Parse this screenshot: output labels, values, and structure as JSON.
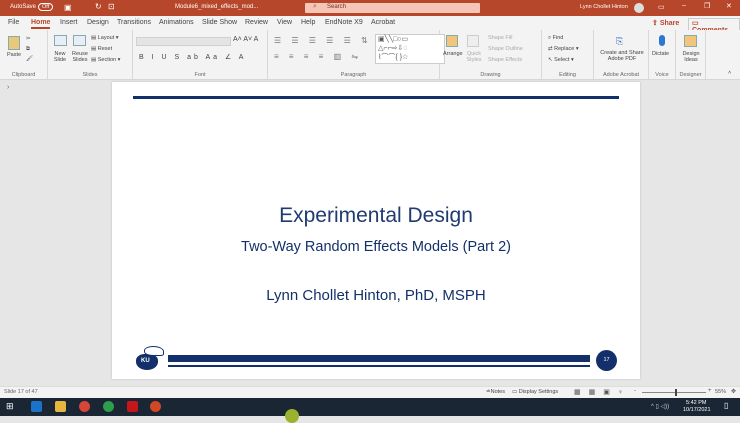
{
  "titlebar": {
    "autosave": "AutoSave",
    "autosave_state": "Off",
    "filename": "Module6_mixed_effects_mod...",
    "search_placeholder": "Search",
    "user": "Lynn Chollet Hinton",
    "accent": "#b7472a"
  },
  "tabs": [
    "File",
    "Home",
    "Insert",
    "Design",
    "Transitions",
    "Animations",
    "Slide Show",
    "Review",
    "View",
    "Help",
    "EndNote X9",
    "Acrobat"
  ],
  "active_tab": "Home",
  "share": "Share",
  "comments": "Comments",
  "ribbon": {
    "clipboard": {
      "label": "Clipboard",
      "paste": "Paste"
    },
    "slides": {
      "label": "Slides",
      "new_slide": "New Slide",
      "reuse": "Reuse Slides",
      "layout": "Layout",
      "reset": "Reset",
      "section": "Section"
    },
    "font": {
      "label": "Font"
    },
    "paragraph": {
      "label": "Paragraph"
    },
    "drawing": {
      "label": "Drawing",
      "arrange": "Arrange",
      "quick_styles": "Quick Styles",
      "shape_fill": "Shape Fill",
      "shape_outline": "Shape Outline",
      "shape_effects": "Shape Effects"
    },
    "editing": {
      "label": "Editing",
      "find": "Find",
      "replace": "Replace",
      "select": "Select"
    },
    "acrobat": {
      "label": "Adobe Acrobat",
      "create": "Create and Share Adobe PDF"
    },
    "voice": {
      "label": "Voice",
      "dictate": "Dictate"
    },
    "designer": {
      "label": "Designer",
      "design_ideas": "Design Ideas"
    }
  },
  "slide": {
    "title": "Experimental Design",
    "subtitle": "Two-Way Random Effects Models (Part 2)",
    "author": "Lynn Chollet Hinton, PhD, MSPH",
    "number": "17",
    "logo_text": "KU",
    "navy": "#13306b"
  },
  "status": {
    "slide_info": "Slide 17 of 47",
    "notes": "Notes",
    "display_settings": "Display Settings",
    "zoom": "55%"
  },
  "taskbar": {
    "time": "5:42 PM",
    "date": "10/17/2021"
  }
}
